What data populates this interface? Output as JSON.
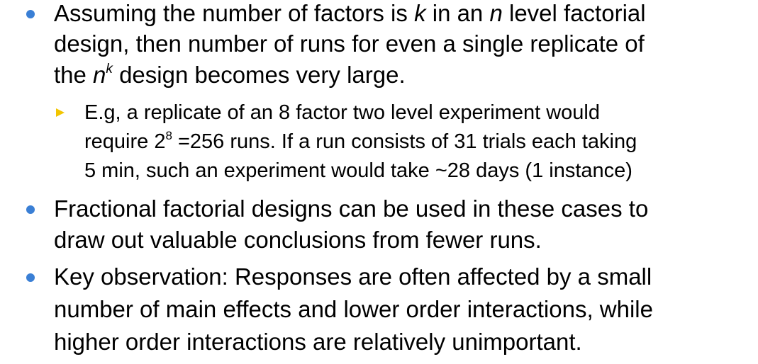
{
  "bullets": [
    {
      "lines": [
        {
          "t1": "Assuming the number of factors is ",
          "k": "k",
          "t2": " in an ",
          "n": "n",
          "t3": " level factorial"
        },
        "design, then number of runs for even a single replicate of",
        {
          "pre": "the ",
          "base": "n",
          "exp": "k",
          "post": " design becomes very large."
        }
      ],
      "sub": {
        "lines": [
          "E.g, a replicate of an 8 factor two level experiment would",
          {
            "pre": "require 2",
            "exp": "8",
            "post": " =256 runs. If a run consists of 31 trials each taking"
          },
          "5 min, such an experiment would take ~28 days (1 instance)"
        ]
      }
    },
    {
      "lines": [
        "Fractional factorial designs can be used in these cases to",
        "draw out valuable conclusions from fewer runs."
      ]
    },
    {
      "lines": [
        "Key observation: Responses are often affected by a small",
        "number of main effects and lower order interactions, while",
        "higher order interactions are relatively unimportant."
      ]
    }
  ],
  "colors": {
    "bullet": "#3a7fd5",
    "sub_bullet": "#f2c500"
  }
}
